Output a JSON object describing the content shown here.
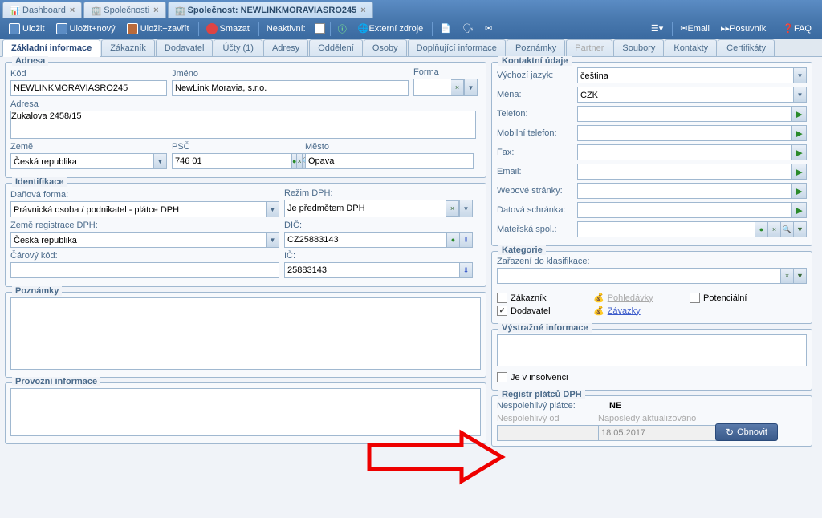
{
  "wtabs": [
    {
      "label": "Dashboard"
    },
    {
      "label": "Společnosti"
    },
    {
      "label": "Společnost: NEWLINKMORAVIASRO245"
    }
  ],
  "toolbar": {
    "save": "Uložit",
    "savenew": "Uložit+nový",
    "saveclose": "Uložit+zavřít",
    "delete": "Smazat",
    "inactive": "Neaktivní:",
    "external": "Externí zdroje",
    "email": "Email",
    "slider": "Posuvník",
    "faq": "FAQ"
  },
  "subtabs": [
    "Základní informace",
    "Zákazník",
    "Dodavatel",
    "Účty (1)",
    "Adresy",
    "Oddělení",
    "Osoby",
    "Doplňující informace",
    "Poznámky",
    "Partner",
    "Soubory",
    "Kontakty",
    "Certifikáty"
  ],
  "adresa": {
    "title": "Adresa",
    "kod_label": "Kód",
    "kod": "NEWLINKMORAVIASRO245",
    "jmeno_label": "Jméno",
    "jmeno": "NewLink Moravia, s.r.o.",
    "forma_label": "Forma",
    "forma": "",
    "adresa_label": "Adresa",
    "adresa": "Zukalova 2458/15",
    "zeme_label": "Země",
    "zeme": "Česká republika",
    "psc_label": "PSČ",
    "psc": "746 01",
    "mesto_label": "Město",
    "mesto": "Opava"
  },
  "ident": {
    "title": "Identifikace",
    "danova_label": "Daňová forma:",
    "danova": "Právnická osoba / podnikatel - plátce DPH",
    "rezim_label": "Režim DPH:",
    "rezim": "Je předmětem DPH",
    "zemereg_label": "Země registrace DPH:",
    "zemereg": "Česká republika",
    "dic_label": "DIČ:",
    "dic": "CZ25883143",
    "carovy_label": "Čárový kód:",
    "carovy": "",
    "ic_label": "IČ:",
    "ic": "25883143"
  },
  "poznamky": {
    "title": "Poznámky"
  },
  "provozni": {
    "title": "Provozní informace"
  },
  "kontakt": {
    "title": "Kontaktní údaje",
    "jazyk_label": "Výchozí jazyk:",
    "jazyk": "čeština",
    "mena_label": "Měna:",
    "mena": "CZK",
    "telefon_label": "Telefon:",
    "mobil_label": "Mobilní telefon:",
    "fax_label": "Fax:",
    "email_label": "Email:",
    "web_label": "Webové stránky:",
    "schranka_label": "Datová schránka:",
    "materska_label": "Mateřská spol.:"
  },
  "kategorie": {
    "title": "Kategorie",
    "zarazeni_label": "Zařazení do klasifikace:",
    "zakaznik": "Zákazník",
    "dodavatel": "Dodavatel",
    "pohledavky": "Pohledávky",
    "zavazky": "Závazky",
    "potencialni": "Potenciální"
  },
  "vystraha": {
    "title": "Výstražné informace",
    "insolvence": "Je v insolvenci"
  },
  "registr": {
    "title": "Registr plátců DPH",
    "nesp_label": "Nespolehlivý plátce:",
    "nesp_val": "NE",
    "nespod_label": "Nespolehlivý od",
    "naposledy_label": "Naposledy aktualizováno",
    "naposledy": "18.05.2017",
    "obnovit": "Obnovit"
  }
}
